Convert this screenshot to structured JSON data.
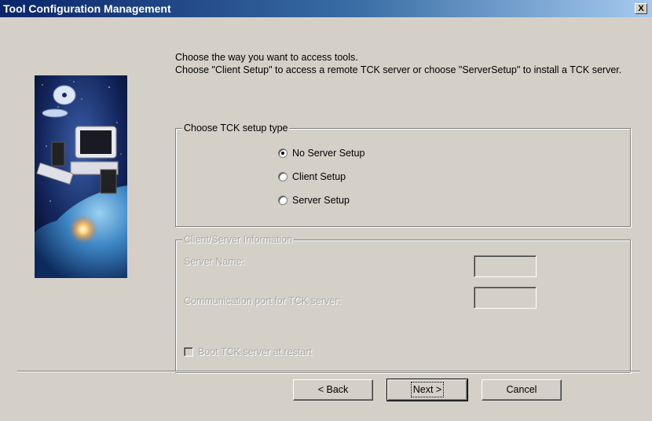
{
  "window": {
    "title": "Tool Configuration Management",
    "close_label": "X"
  },
  "intro": {
    "line1": "Choose the way you want to access tools.",
    "line2": "Choose \"Client Setup\" to access a remote TCK server or choose \"ServerSetup\" to install a TCK server."
  },
  "setup_type": {
    "legend": "Choose TCK setup type",
    "options": [
      {
        "label": "No Server Setup",
        "checked": true
      },
      {
        "label": "Client Setup",
        "checked": false
      },
      {
        "label": "Server Setup",
        "checked": false
      }
    ]
  },
  "client_server": {
    "legend": "Client/Server Information",
    "server_name_label": "Server Name:",
    "server_name_value": "",
    "port_label": "Communication port for TCK server:",
    "port_value": "",
    "boot_label": "Boot TCK server at restart",
    "boot_checked": false
  },
  "buttons": {
    "back": "< Back",
    "next": "Next >",
    "cancel": "Cancel"
  },
  "colors": {
    "face": "#d4d0c8",
    "title_start": "#0a246a",
    "title_end": "#a6caf0"
  },
  "icons": [
    "close-icon",
    "wizard-illustration"
  ]
}
